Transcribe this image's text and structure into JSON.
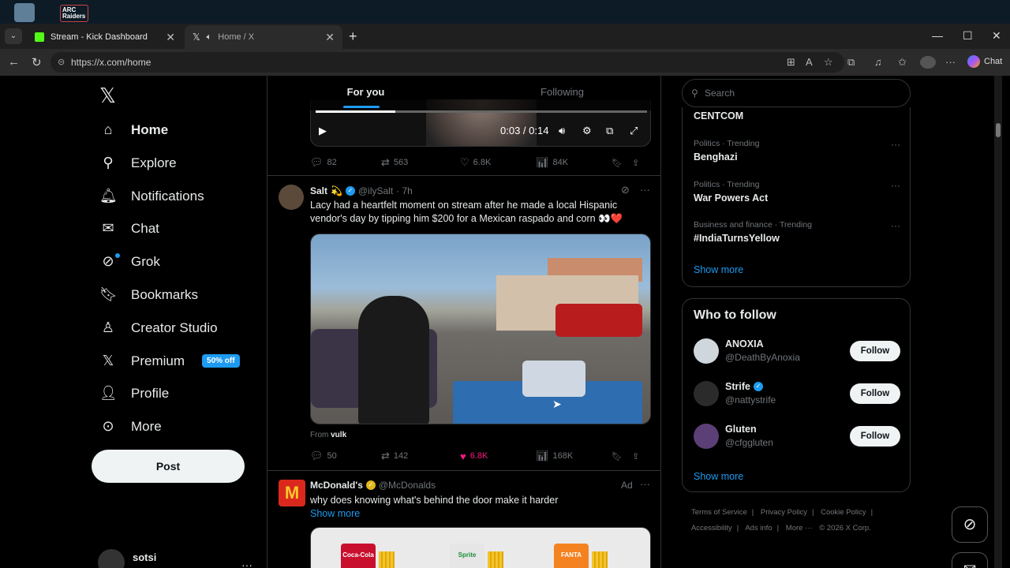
{
  "browser": {
    "tabs": [
      {
        "title": "Stream - Kick Dashboard",
        "favicon": "kick-icon",
        "color": "#53fc18"
      },
      {
        "title": "Home / X",
        "favicon": "x-icon",
        "muted": true
      }
    ],
    "url": "https://x.com/home",
    "chat_label": "Chat"
  },
  "nav": {
    "items": [
      {
        "label": "Home",
        "icon": "home-icon"
      },
      {
        "label": "Explore",
        "icon": "search-icon"
      },
      {
        "label": "Notifications",
        "icon": "bell-icon"
      },
      {
        "label": "Chat",
        "icon": "mail-icon"
      },
      {
        "label": "Grok",
        "icon": "grok-icon"
      },
      {
        "label": "Bookmarks",
        "icon": "bookmark-icon"
      },
      {
        "label": "Creator Studio",
        "icon": "creator-icon"
      },
      {
        "label": "Premium",
        "icon": "x-icon"
      },
      {
        "label": "Profile",
        "icon": "person-icon"
      },
      {
        "label": "More",
        "icon": "more-circle-icon"
      }
    ],
    "premium_badge": "50% off",
    "post_label": "Post",
    "account_name": "sotsi"
  },
  "feed": {
    "tabs": [
      "For you",
      "Following"
    ],
    "video1": {
      "time": "0:03 / 0:14",
      "progress": 0.24
    },
    "tweet1_stats": {
      "replies": "82",
      "reposts": "563",
      "likes": "6.8K",
      "views": "84K"
    },
    "tweet2": {
      "name": "Salt",
      "emoji": "💫",
      "handle": "@ilySalt",
      "time": "· 7h",
      "text": "Lacy had a heartfelt moment on stream after he made a local Hispanic vendor's day by tipping him $200 for a Mexican raspado and corn 👀❤️",
      "from_label": "From",
      "from_user": "vulk",
      "stats": {
        "replies": "50",
        "reposts": "142",
        "likes": "6.8K",
        "views": "168K"
      }
    },
    "tweet3": {
      "name": "McDonald's",
      "handle": "@McDonalds",
      "ad_label": "Ad",
      "text": "why does knowing what's behind the door make it harder",
      "show_more": "Show more",
      "cup_labels": [
        "Coca-Cola",
        "Sprite",
        "FANTA"
      ]
    }
  },
  "right": {
    "search_placeholder": "Search",
    "top_trend": "CENTCOM",
    "trends": [
      {
        "category": "Politics · Trending",
        "title": "Benghazi"
      },
      {
        "category": "Politics · Trending",
        "title": "War Powers Act"
      },
      {
        "category": "Business and finance · Trending",
        "title": "#IndiaTurnsYellow"
      }
    ],
    "show_more": "Show more",
    "who_to_follow": {
      "title": "Who to follow",
      "users": [
        {
          "name": "ANOXIA",
          "handle": "@DeathByAnoxia",
          "verified": false
        },
        {
          "name": "Strife",
          "handle": "@nattystrife",
          "verified": true
        },
        {
          "name": "Gluten",
          "handle": "@cfggluten",
          "verified": false
        }
      ],
      "follow_label": "Follow",
      "show_more": "Show more"
    },
    "footer": {
      "line1": [
        "Terms of Service",
        "|",
        "Privacy Policy",
        "|",
        "Cookie Policy",
        "|"
      ],
      "line2": [
        "Accessibility",
        "|",
        "Ads info",
        "|",
        "More ···",
        "© 2026 X Corp."
      ]
    }
  }
}
